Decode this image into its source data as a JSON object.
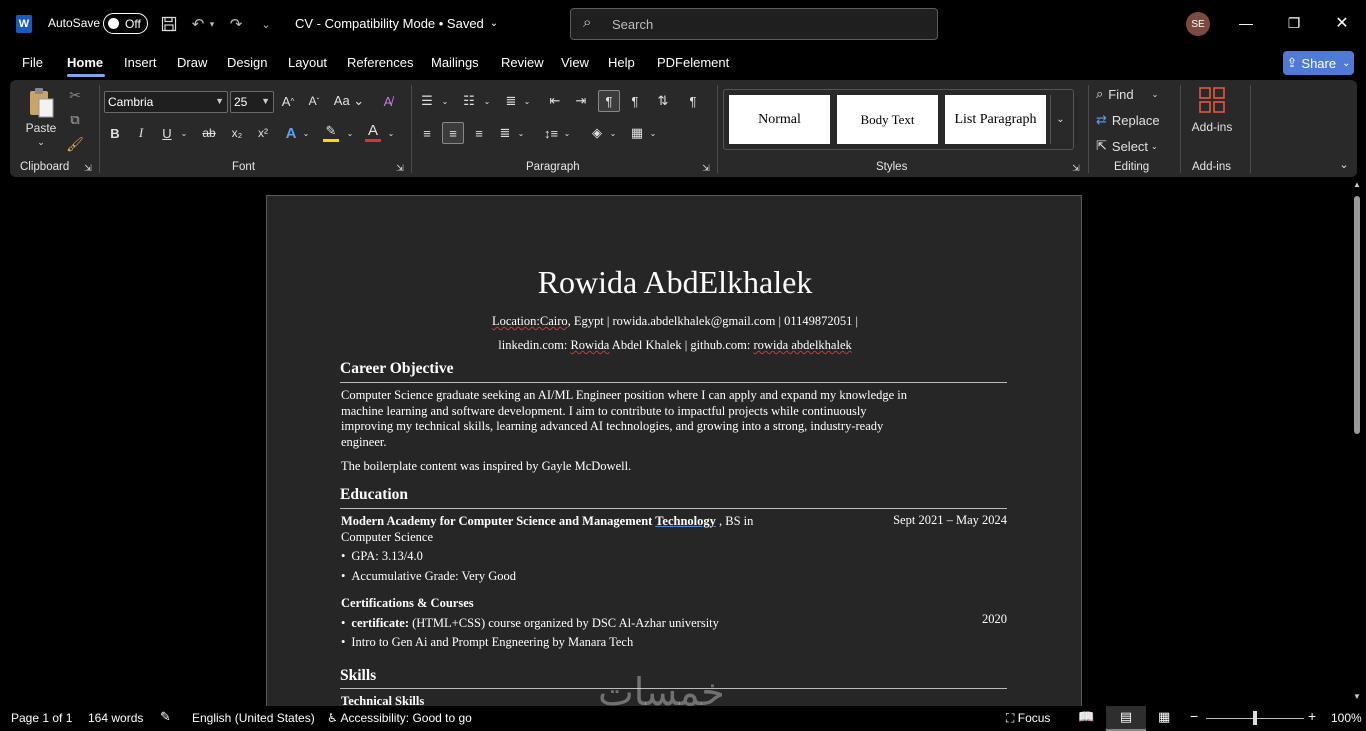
{
  "titlebar": {
    "autosave_label": "AutoSave",
    "autosave_state": "Off",
    "doc_title": "CV  -  Compatibility Mode • Saved",
    "search_placeholder": "Search",
    "user_initials": "SE"
  },
  "tabs": [
    "File",
    "Home",
    "Insert",
    "Draw",
    "Design",
    "Layout",
    "References",
    "Mailings",
    "Review",
    "View",
    "Help",
    "PDFelement"
  ],
  "active_tab": "Home",
  "share_label": "Share",
  "ribbon": {
    "clipboard": {
      "paste": "Paste",
      "label": "Clipboard"
    },
    "font": {
      "font_name": "Cambria",
      "font_size": "25",
      "label": "Font",
      "bold": "B",
      "italic": "I",
      "underline": "U",
      "strike": "ab",
      "subscript": "x₂",
      "superscript": "x²"
    },
    "paragraph": {
      "label": "Paragraph"
    },
    "styles": {
      "label": "Styles",
      "items": [
        "Normal",
        "Body Text",
        "List Paragraph"
      ]
    },
    "editing": {
      "label": "Editing",
      "find": "Find",
      "replace": "Replace",
      "select": "Select"
    },
    "addins": {
      "label": "Add-ins",
      "button": "Add-ins"
    }
  },
  "document": {
    "name": "Rowida AbdElkhalek",
    "contact_line1": {
      "location_label": "Location:Cairo",
      "location_rest": ", Egypt  |  rowida.abdelkhalek@gmail.com  |  01149872051  |"
    },
    "contact_line2": {
      "linkedin_label": "linkedin.com: ",
      "linkedin_name": "Rowida",
      "linkedin_rest": " Abdel Khalek  |  github.com: ",
      "github_name": "rowida abdelkhalek"
    },
    "career_heading": "Career Objective",
    "career_lines": [
      "Computer Science graduate seeking an AI/ML Engineer position where I can apply and expand my knowledge in",
      "machine learning and software development.  I aim to contribute to impactful projects while continuously",
      "improving my technical skills, learning advanced AI technologies, and growing into a strong, industry-ready",
      "engineer."
    ],
    "boilerplate": "The boilerplate content was inspired by Gayle McDowell.",
    "education_heading": "Education",
    "edu_school_bold": "Modern Academy for Computer Science and Management ",
    "edu_school_tech": "Technology",
    "edu_school_rest": " , BS in",
    "edu_school_line2": "Computer Science",
    "edu_dates": "Sept 2021 – May 2024",
    "edu_bullets": [
      "GPA: 3.13/4.0",
      "Accumulative Grade: Very Good"
    ],
    "cert_heading": "Certifications & Courses",
    "cert1_bold": "certificate:",
    "cert1_rest": " (HTML+CSS) course organized by DSC Al-Azhar university",
    "cert1_year": "2020",
    "cert2": "Intro to Gen Ai and Prompt Engneering by Manara Tech",
    "skills_heading": "Skills",
    "tech_skills_heading": "Technical Skills"
  },
  "statusbar": {
    "page": "Page 1 of 1",
    "words": "164 words",
    "language": "English (United States)",
    "accessibility": "Accessibility: Good to go",
    "focus": "Focus",
    "zoom": "100%"
  },
  "watermark": "خمسات"
}
